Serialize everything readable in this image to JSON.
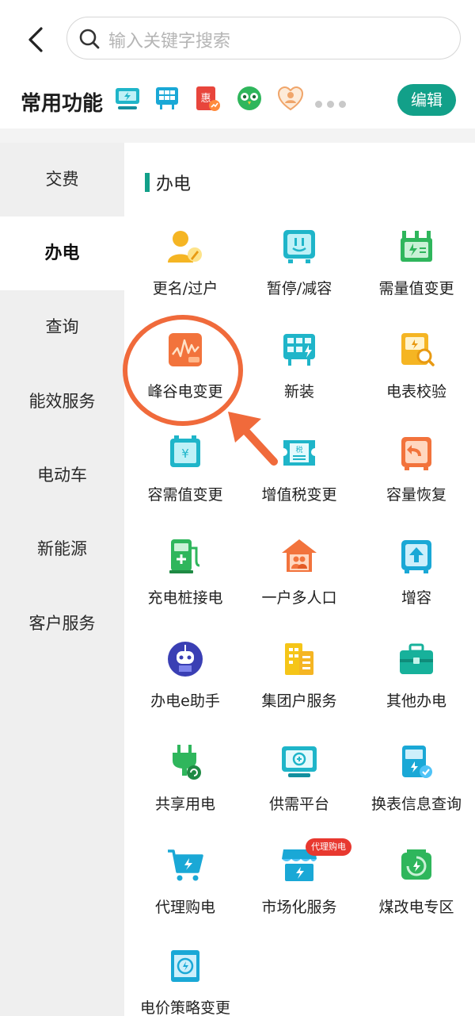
{
  "search": {
    "placeholder": "输入关键字搜索"
  },
  "favorites": {
    "title": "常用功能",
    "icons": [
      "monitor-icon",
      "meter-icon",
      "discount-icon",
      "owl-icon",
      "heart-user-icon"
    ],
    "edit_label": "编辑"
  },
  "sidebar": {
    "items": [
      {
        "label": "交费",
        "active": false
      },
      {
        "label": "办电",
        "active": true
      },
      {
        "label": "查询",
        "active": false
      },
      {
        "label": "能效服务",
        "active": false
      },
      {
        "label": "电动车",
        "active": false
      },
      {
        "label": "新能源",
        "active": false
      },
      {
        "label": "客户服务",
        "active": false
      }
    ]
  },
  "section": {
    "title": "办电"
  },
  "tiles": [
    {
      "label": "更名/过户",
      "icon": "user-edit-icon"
    },
    {
      "label": "暂停/减容",
      "icon": "pause-box-icon"
    },
    {
      "label": "需量值变更",
      "icon": "transformer-icon"
    },
    {
      "label": "峰谷电变更",
      "icon": "peak-valley-chart-icon"
    },
    {
      "label": "新装",
      "icon": "new-meter-icon"
    },
    {
      "label": "电表校验",
      "icon": "meter-check-icon"
    },
    {
      "label": "容需值变更",
      "icon": "capacity-change-icon"
    },
    {
      "label": "增值税变更",
      "icon": "tax-ticket-icon"
    },
    {
      "label": "容量恢复",
      "icon": "capacity-restore-icon"
    },
    {
      "label": "充电桩接电",
      "icon": "charging-pile-icon"
    },
    {
      "label": "一户多人口",
      "icon": "household-icon"
    },
    {
      "label": "增容",
      "icon": "capacity-up-icon"
    },
    {
      "label": "办电e助手",
      "icon": "robot-assistant-icon"
    },
    {
      "label": "集团户服务",
      "icon": "group-building-icon"
    },
    {
      "label": "其他办电",
      "icon": "toolbox-icon"
    },
    {
      "label": "共享用电",
      "icon": "shared-plug-icon"
    },
    {
      "label": "供需平台",
      "icon": "supply-demand-screen-icon"
    },
    {
      "label": "换表信息查询",
      "icon": "meter-info-icon"
    },
    {
      "label": "代理购电",
      "icon": "cart-lightning-icon"
    },
    {
      "label": "市场化服务",
      "icon": "market-store-icon"
    },
    {
      "label": "煤改电专区",
      "icon": "coal-to-power-icon"
    },
    {
      "label": "电价策略变更",
      "icon": "price-strategy-icon"
    }
  ],
  "badge": {
    "label": "代理购电"
  },
  "colors": {
    "accent": "#12a089",
    "annotation": "#f06a3b",
    "badge": "#e8382f"
  }
}
